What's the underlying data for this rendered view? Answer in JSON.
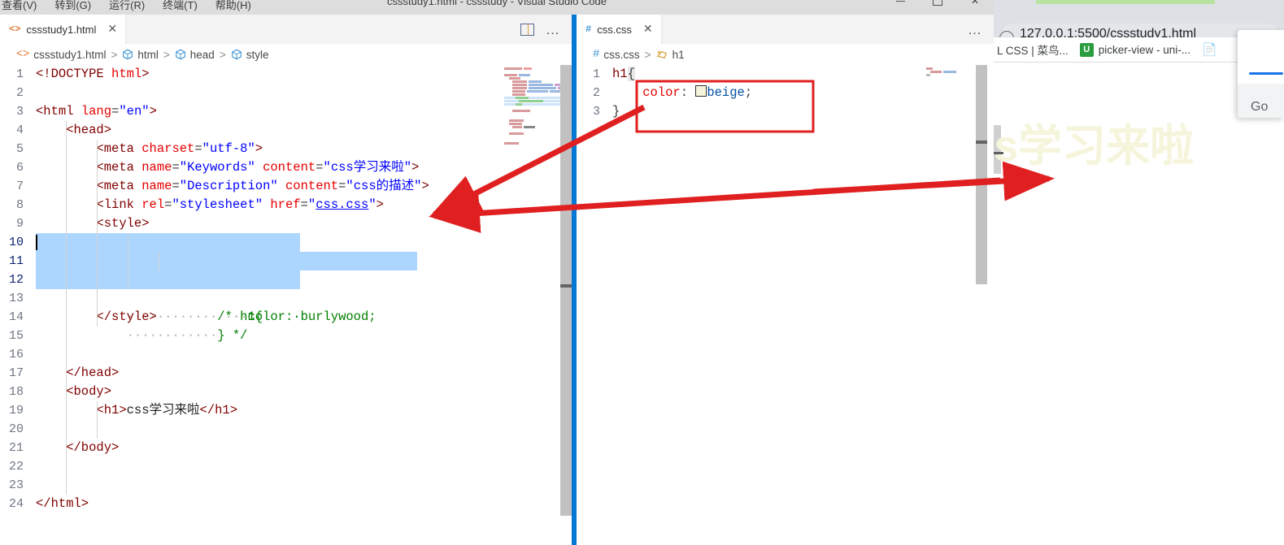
{
  "window": {
    "title": "cssstudy1.html - cssstudy - Visual Studio Code",
    "menu": [
      "查看(V)",
      "转到(G)",
      "运行(R)",
      "终端(T)",
      "帮助(H)"
    ],
    "controls": {
      "minimize": "—",
      "maximize": "□",
      "close": "✕"
    }
  },
  "left_group": {
    "tab": {
      "label": "cssstudy1.html",
      "icon": "<>",
      "close": "✕"
    },
    "actions": {
      "split_title": "Split Editor",
      "more": "…"
    },
    "breadcrumb": [
      "cssstudy1.html",
      "html",
      "head",
      "style"
    ],
    "lines": [
      {
        "n": "1",
        "text": "<!DOCTYPE html>"
      },
      {
        "n": "2",
        "text": ""
      },
      {
        "n": "3",
        "text": "<html lang=\"en\">"
      },
      {
        "n": "4",
        "text": "    <head>"
      },
      {
        "n": "5",
        "text": "        <meta charset=\"utf-8\">"
      },
      {
        "n": "6",
        "text": "        <meta name=\"Keywords\" content=\"css学习来啦\">"
      },
      {
        "n": "7",
        "text": "        <meta name=\"Description\" content=\"css的描述\">"
      },
      {
        "n": "8",
        "text": "        <link rel=\"stylesheet\" href=\"css.css\">"
      },
      {
        "n": "9",
        "text": "        <style>"
      },
      {
        "n": "10",
        "text": "            /* h1{"
      },
      {
        "n": "11",
        "text": "                color: burlywood;"
      },
      {
        "n": "12",
        "text": "            } */"
      },
      {
        "n": "13",
        "text": ""
      },
      {
        "n": "14",
        "text": "        </style>"
      },
      {
        "n": "15",
        "text": ""
      },
      {
        "n": "16",
        "text": ""
      },
      {
        "n": "17",
        "text": "    </head>"
      },
      {
        "n": "18",
        "text": "    <body>"
      },
      {
        "n": "19",
        "text": "        <h1>css学习来啦</h1>"
      },
      {
        "n": "20",
        "text": ""
      },
      {
        "n": "21",
        "text": "    </body>"
      },
      {
        "n": "22",
        "text": ""
      },
      {
        "n": "23",
        "text": ""
      },
      {
        "n": "24",
        "text": "</html>"
      }
    ],
    "selected_lines": [
      10,
      11,
      12
    ],
    "link_text": "css.css"
  },
  "right_group": {
    "tab": {
      "label": "css.css",
      "icon": "#",
      "close": "✕"
    },
    "actions": {
      "more": "…"
    },
    "breadcrumb": [
      "css.css",
      "h1"
    ],
    "lines": [
      {
        "n": "1",
        "text": "h1{"
      },
      {
        "n": "2",
        "text": "    color: beige;"
      },
      {
        "n": "3",
        "text": "}"
      }
    ],
    "color_swatch": "#f5f5dc"
  },
  "browser": {
    "url": "127.0.0.1:5500/cssstudy1.html",
    "bookmarks": [
      {
        "label": "L CSS | 菜鸟...",
        "icon": "none"
      },
      {
        "label": "picker-view - uni-...",
        "icon": "letter-u"
      }
    ],
    "page_heading": "css学习来啦",
    "heading_color": "#f5f5dc",
    "popup_text": "Go"
  },
  "annotations": {
    "color": "#e02020",
    "box_label": "highlight-css-rule",
    "arrow_count": 3
  }
}
